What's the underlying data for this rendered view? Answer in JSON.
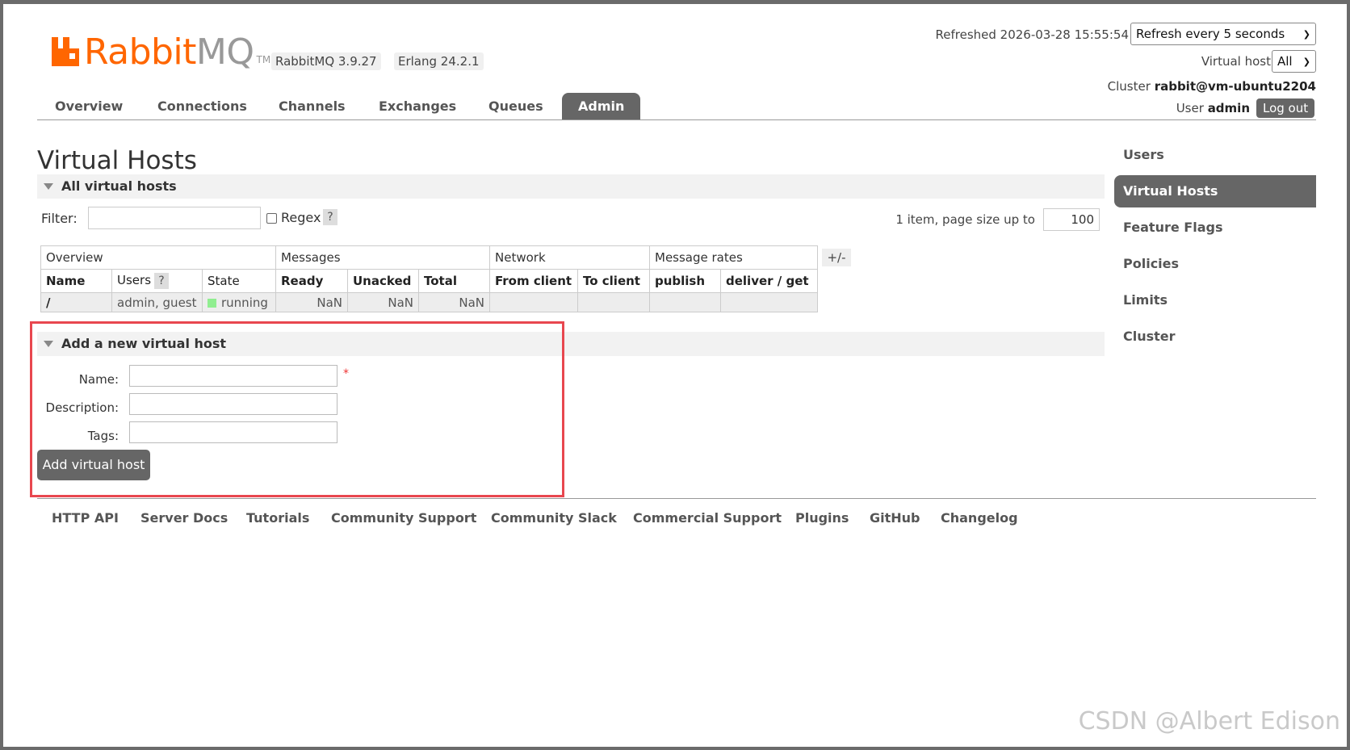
{
  "brand": {
    "logo_part1": "Rabbit",
    "logo_part2": "MQ",
    "tm": "TM"
  },
  "versions": {
    "rabbitmq": "RabbitMQ 3.9.27",
    "erlang": "Erlang 24.2.1"
  },
  "status": {
    "refreshed": "Refreshed 2026-03-28 15:55:54",
    "refresh_option": "Refresh every 5 seconds",
    "vhost_label": "Virtual host",
    "vhost_value": "All",
    "cluster_label": "Cluster",
    "cluster_value": "rabbit@vm-ubuntu2204",
    "user_label": "User",
    "user_value": "admin",
    "logout": "Log out"
  },
  "tabs": [
    "Overview",
    "Connections",
    "Channels",
    "Exchanges",
    "Queues",
    "Admin"
  ],
  "active_tab": "Admin",
  "page": {
    "title": "Virtual Hosts",
    "section_all": "All virtual hosts",
    "filter_label": "Filter:",
    "regex_label": "Regex",
    "help": "?",
    "paging_text": "1 item, page size up to",
    "page_size": "100"
  },
  "table": {
    "groups": [
      "Overview",
      "Messages",
      "Network",
      "Message rates"
    ],
    "columns": [
      "Name",
      "Users",
      "State",
      "Ready",
      "Unacked",
      "Total",
      "From client",
      "To client",
      "publish",
      "deliver / get"
    ],
    "rows": [
      {
        "name": "/",
        "users": "admin, guest",
        "state": "running",
        "ready": "NaN",
        "unacked": "NaN",
        "total": "NaN",
        "from_client": "",
        "to_client": "",
        "publish": "",
        "deliver_get": ""
      }
    ],
    "toggle": "+/-"
  },
  "add_form": {
    "title": "Add a new virtual host",
    "name_label": "Name:",
    "description_label": "Description:",
    "tags_label": "Tags:",
    "required_mark": "*",
    "submit": "Add virtual host"
  },
  "sidebar": [
    "Users",
    "Virtual Hosts",
    "Feature Flags",
    "Policies",
    "Limits",
    "Cluster"
  ],
  "sidebar_active": "Virtual Hosts",
  "footer": [
    "HTTP API",
    "Server Docs",
    "Tutorials",
    "Community Support",
    "Community Slack",
    "Commercial Support",
    "Plugins",
    "GitHub",
    "Changelog"
  ],
  "watermark": "CSDN @Albert Edison",
  "colors": {
    "brand_orange": "#ff6600",
    "tab_active": "#666666",
    "state_running": "#90ee90",
    "highlight_box": "#e8474f"
  }
}
